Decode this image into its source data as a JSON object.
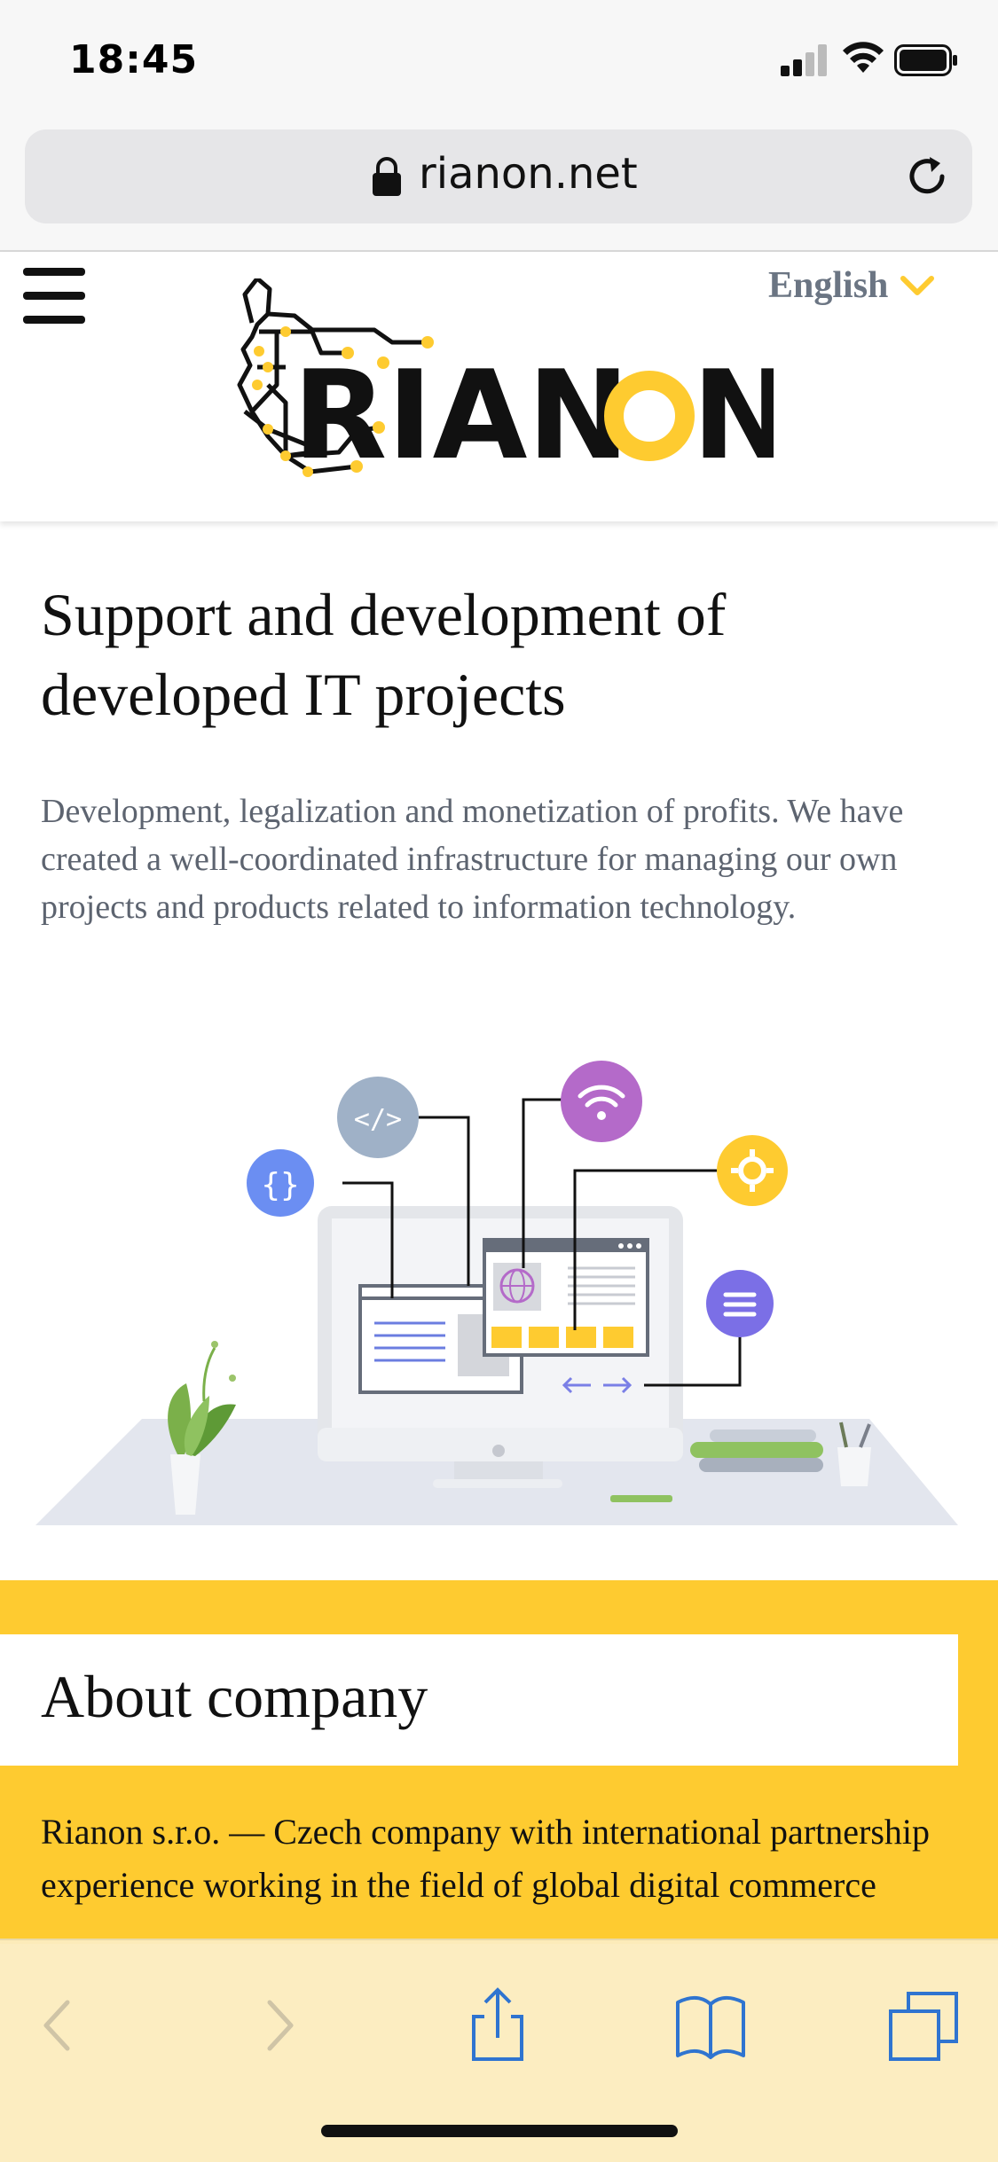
{
  "status_bar": {
    "time": "18:45"
  },
  "browser": {
    "url": "rianon.net"
  },
  "header": {
    "logo_text": "RIANON",
    "language": "English"
  },
  "hero": {
    "title": "Support and development of developed IT projects",
    "description": "Development, legalization and monetization of profits. We have created a well-coordinated infrastructure for managing our own projects and products related to information technology."
  },
  "about": {
    "title": "About company",
    "text": "Rianon s.r.o. — Czech company with international partnership experience working in the field of global digital commerce"
  },
  "colors": {
    "accent_yellow": "#fecb30",
    "text_dark": "#111111",
    "text_gray": "#5d6470",
    "toolbar_blue": "#2f74d0",
    "toolbar_disabled": "#cfc4a6"
  },
  "toolbar": {
    "icons": [
      "back-icon",
      "forward-icon",
      "share-icon",
      "bookmarks-icon",
      "tabs-icon"
    ]
  }
}
